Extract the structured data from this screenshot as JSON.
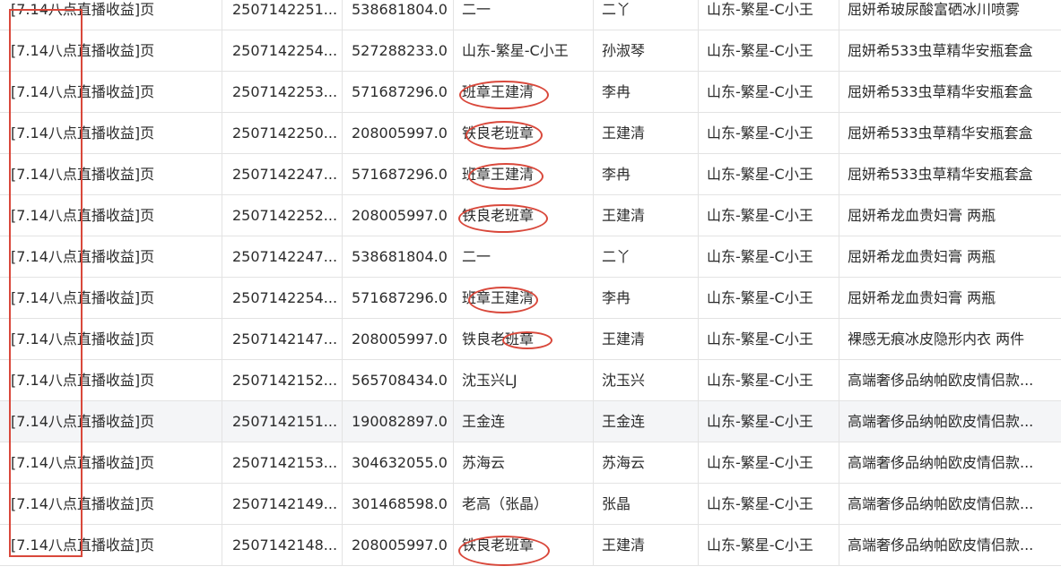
{
  "table": {
    "rows": [
      [
        "[7.14八点直播收益]页",
        "2507142251...",
        "538681804.0",
        "二一",
        "二丫",
        "山东-繁星-C小王",
        "屈妍希玻尿酸富硒冰川喷雾"
      ],
      [
        "[7.14八点直播收益]页",
        "2507142254...",
        "527288233.0",
        "山东-繁星-C小王",
        "孙淑琴",
        "山东-繁星-C小王",
        "屈妍希533虫草精华安瓶套盒"
      ],
      [
        "[7.14八点直播收益]页",
        "2507142253...",
        "571687296.0",
        "班章王建清",
        "李冉",
        "山东-繁星-C小王",
        "屈妍希533虫草精华安瓶套盒"
      ],
      [
        "[7.14八点直播收益]页",
        "2507142250...",
        "208005997.0",
        "铁良老班章",
        "王建清",
        "山东-繁星-C小王",
        "屈妍希533虫草精华安瓶套盒"
      ],
      [
        "[7.14八点直播收益]页",
        "2507142247...",
        "571687296.0",
        "班章王建清",
        "李冉",
        "山东-繁星-C小王",
        "屈妍希533虫草精华安瓶套盒"
      ],
      [
        "[7.14八点直播收益]页",
        "2507142252...",
        "208005997.0",
        "铁良老班章",
        "王建清",
        "山东-繁星-C小王",
        "屈妍希龙血贵妇膏 两瓶"
      ],
      [
        "[7.14八点直播收益]页",
        "2507142247...",
        "538681804.0",
        "二一",
        "二丫",
        "山东-繁星-C小王",
        "屈妍希龙血贵妇膏 两瓶"
      ],
      [
        "[7.14八点直播收益]页",
        "2507142254...",
        "571687296.0",
        "班章王建清",
        "李冉",
        "山东-繁星-C小王",
        "屈妍希龙血贵妇膏 两瓶"
      ],
      [
        "[7.14八点直播收益]页",
        "2507142147...",
        "208005997.0",
        "铁良老班章",
        "王建清",
        "山东-繁星-C小王",
        "裸感无痕冰皮隐形内衣 两件"
      ],
      [
        "[7.14八点直播收益]页",
        "2507142152...",
        "565708434.0",
        "沈玉兴LJ",
        "沈玉兴",
        "山东-繁星-C小王",
        "高端奢侈品纳帕欧皮情侣款..."
      ],
      [
        "[7.14八点直播收益]页",
        "2507142151...",
        "190082897.0",
        "王金连",
        "王金连",
        "山东-繁星-C小王",
        "高端奢侈品纳帕欧皮情侣款..."
      ],
      [
        "[7.14八点直播收益]页",
        "2507142153...",
        "304632055.0",
        "苏海云",
        "苏海云",
        "山东-繁星-C小王",
        "高端奢侈品纳帕欧皮情侣款..."
      ],
      [
        "[7.14八点直播收益]页",
        "2507142149...",
        "301468598.0",
        "老高（张晶）",
        "张晶",
        "山东-繁星-C小王",
        "高端奢侈品纳帕欧皮情侣款..."
      ],
      [
        "[7.14八点直播收益]页",
        "2507142148...",
        "208005997.0",
        "铁良老班章",
        "王建清",
        "山东-繁星-C小王",
        "高端奢侈品纳帕欧皮情侣款..."
      ]
    ],
    "highlighted_row": 10
  },
  "annotation": {
    "color": "#d9483b"
  }
}
